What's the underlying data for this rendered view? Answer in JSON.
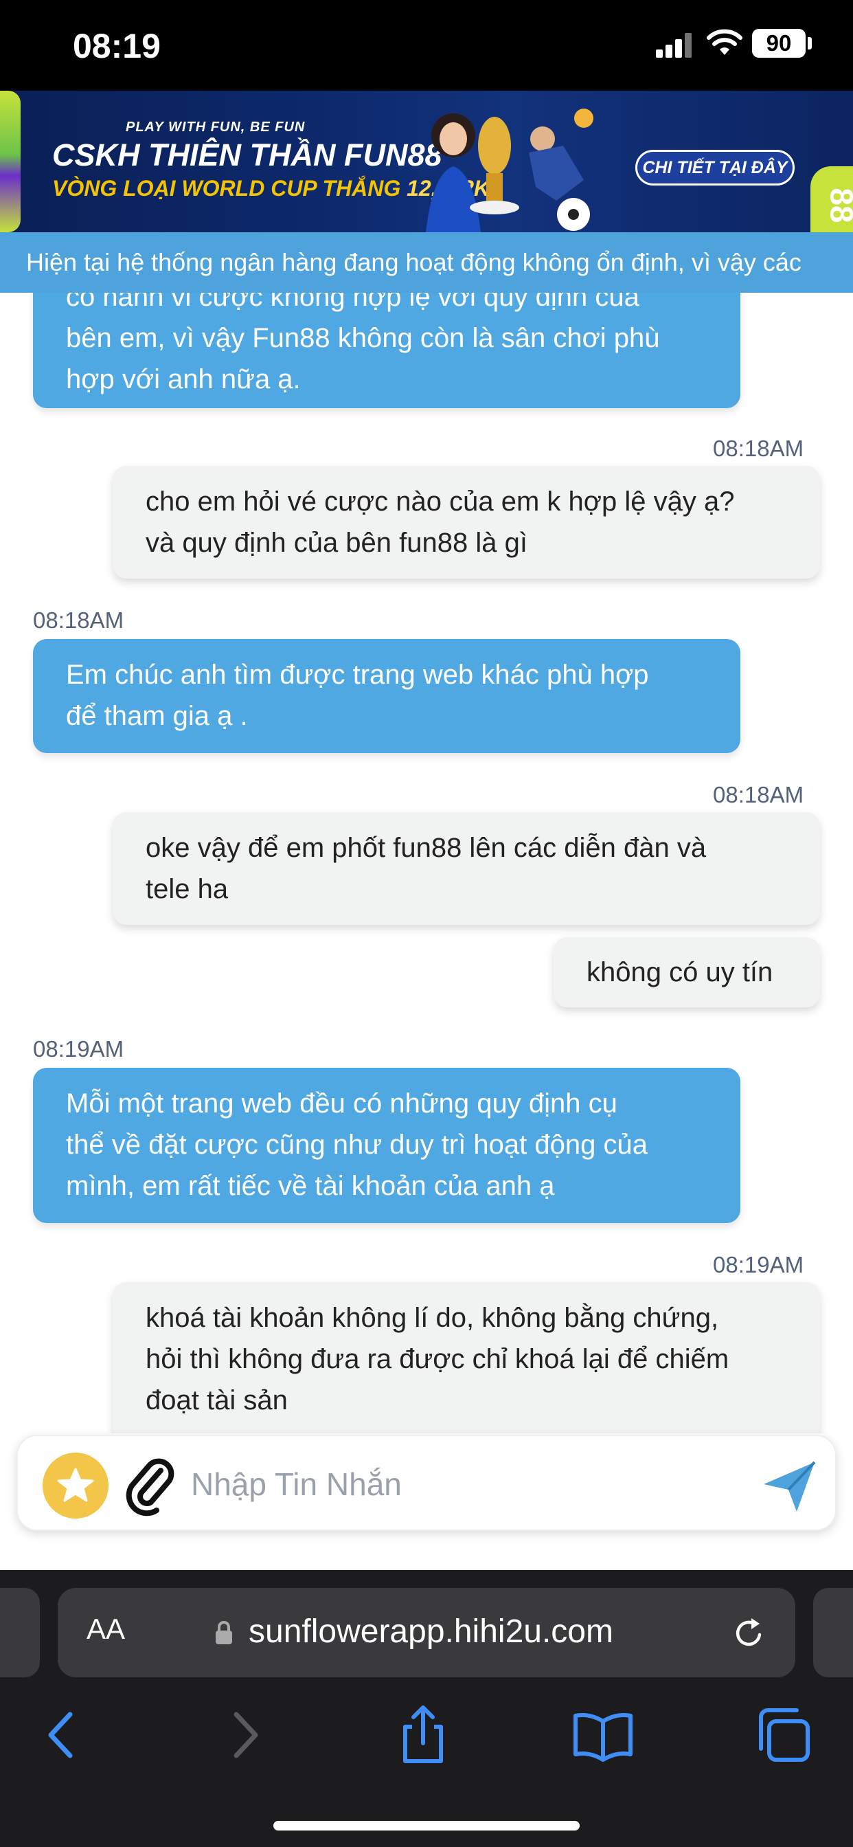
{
  "status_bar": {
    "time": "08:19",
    "battery": "90"
  },
  "banner": {
    "tagline": "PLAY WITH FUN, BE FUN",
    "title": "CSKH THIÊN THẦN FUN88",
    "subtitle_prefix": "VÒNG LOẠI WORLD CUP THẮNG",
    "subtitle_amount": "12,632K",
    "cta": "CHI TIẾT TẠI ĐÂY",
    "side_logo": "88"
  },
  "marquee": {
    "text": "Hiện tại hệ thống ngân hàng đang hoạt động không ổn định, vì vậy các"
  },
  "messages": [
    {
      "side": "in",
      "time": "",
      "lines": [
        "có hành vi cược không hợp lệ với quy định của",
        "bên em, vì vậy Fun88 không còn là sân chơi phù",
        "hợp với anh nữa ạ."
      ]
    },
    {
      "side": "out",
      "time": "08:18AM",
      "lines": [
        "cho em hỏi vé cược nào của em k hợp lệ vậy ạ?",
        "và quy định của bên fun88 là gì"
      ]
    },
    {
      "side": "in",
      "time": "08:18AM",
      "lines": [
        "Em chúc anh tìm được trang web khác phù hợp",
        "để tham gia ạ ."
      ]
    },
    {
      "side": "out",
      "time": "08:18AM",
      "lines": [
        "oke vậy để em phốt fun88 lên các diễn đàn và",
        "tele ha"
      ]
    },
    {
      "side": "out",
      "time": "",
      "lines": [
        "không có uy tín"
      ]
    },
    {
      "side": "in",
      "time": "08:19AM",
      "lines": [
        "Mỗi một trang web đều có những quy định cụ",
        "thể về đặt cược cũng như duy trì hoạt động của",
        "mình, em rất tiếc về tài khoản của anh ạ"
      ]
    },
    {
      "side": "out",
      "time": "08:19AM",
      "lines": [
        "khoá tài khoản không lí do, không bằng chứng,",
        "hỏi thì không đưa ra được chỉ khoá lại để chiếm",
        "đoạt tài sản"
      ]
    }
  ],
  "composer": {
    "placeholder": "Nhập Tin Nhắn"
  },
  "browser": {
    "aa": "AA",
    "url": "sunflowerapp.hihi2u.com"
  },
  "colors": {
    "incoming": "#4fa8e2",
    "outgoing": "#f1f2f2",
    "accent": "#4fa3dc"
  }
}
